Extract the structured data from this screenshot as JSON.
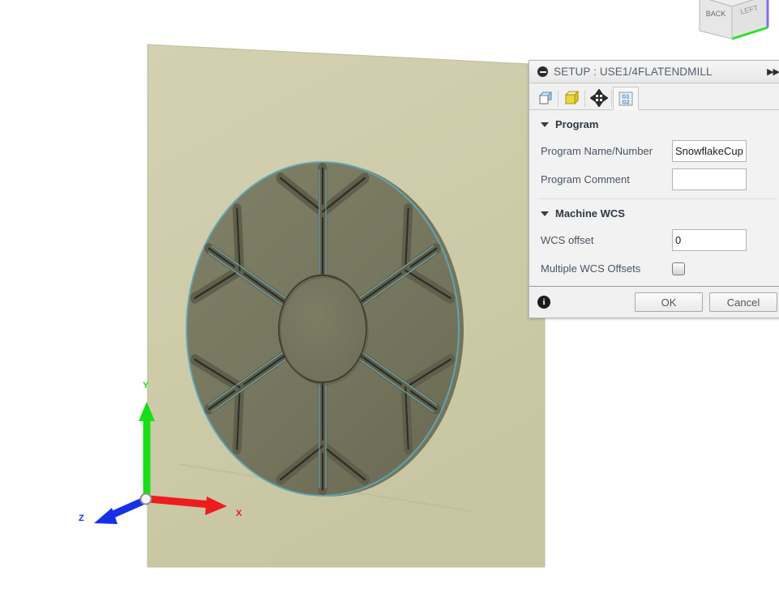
{
  "app": {
    "viewport_background": "#ffffff",
    "stock_color": "#cdcba8",
    "part_color": "#76765e",
    "highlight_color": "#5bb8d4"
  },
  "viewcube": {
    "face_back_label": "BACK",
    "face_left_label": "LEFT",
    "axis_y_color": "#2ee02e",
    "axis_z_color": "#7b72e8"
  },
  "triad": {
    "x_label": "X",
    "y_label": "Y",
    "z_label": "Z",
    "x_color": "#ee1c1c",
    "y_color": "#18de18",
    "z_color": "#1630e8"
  },
  "dialog": {
    "title": "SETUP : USE1/4FLATENDMILL",
    "collapse_icon": "collapse-minus-icon",
    "expand_icon": "double-chevron-right-icon",
    "tabs": [
      {
        "name": "setup",
        "icon": "setup-cube-icon",
        "active": false
      },
      {
        "name": "stock",
        "icon": "stock-box-icon",
        "active": false
      },
      {
        "name": "post-position",
        "icon": "move-arrows-icon",
        "active": false
      },
      {
        "name": "post-process",
        "icon": "g-code-icon",
        "label_top": "G1",
        "label_bottom": "G2",
        "active": true
      }
    ],
    "groups": [
      {
        "name": "program",
        "title": "Program",
        "expanded": true,
        "rows": [
          {
            "name": "program-name-number",
            "label": "Program Name/Number",
            "type": "text",
            "value": "SnowflakeCup",
            "placeholder": ""
          },
          {
            "name": "program-comment",
            "label": "Program Comment",
            "type": "text",
            "value": "",
            "placeholder": ""
          }
        ]
      },
      {
        "name": "machine-wcs",
        "title": "Machine WCS",
        "expanded": true,
        "rows": [
          {
            "name": "wcs-offset",
            "label": "WCS offset",
            "type": "text",
            "value": "0",
            "placeholder": ""
          },
          {
            "name": "multiple-wcs-offsets",
            "label": "Multiple WCS Offsets",
            "type": "checkbox",
            "checked": false
          }
        ]
      }
    ],
    "footer": {
      "info_icon": "info-icon",
      "ok_label": "OK",
      "cancel_label": "Cancel"
    }
  }
}
